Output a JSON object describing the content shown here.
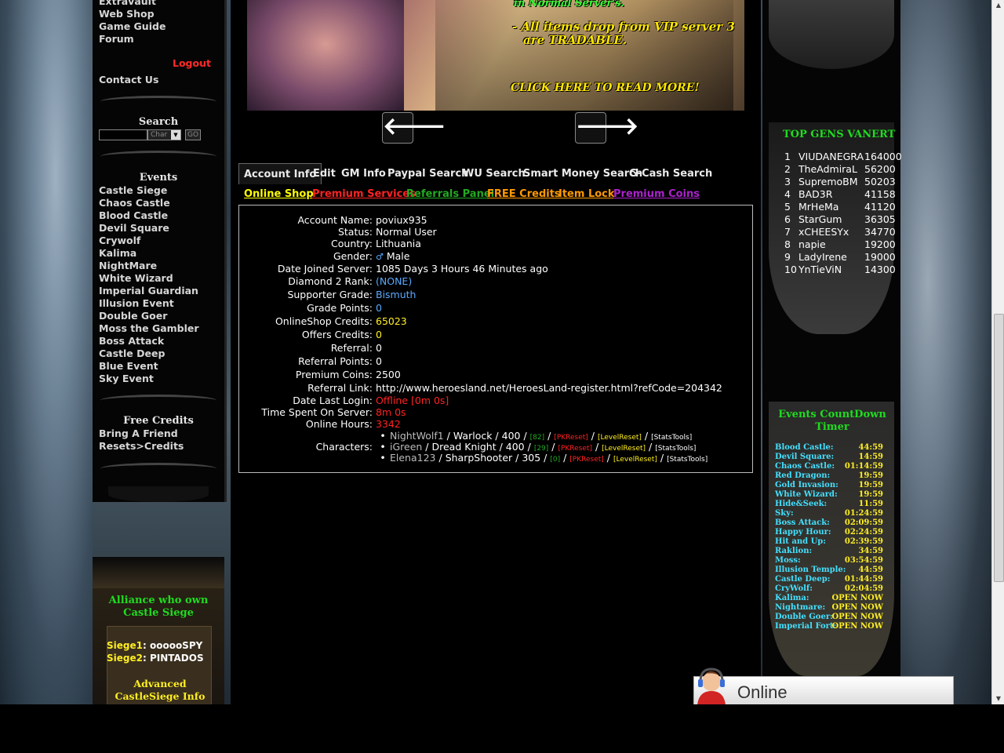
{
  "left_menu": {
    "top_links": [
      "Extravault",
      "Web Shop",
      "Game Guide",
      "Forum"
    ],
    "logout": "Logout",
    "contact": "Contact Us",
    "search": {
      "heading": "Search",
      "select_value": "Char",
      "go_label": "GO"
    },
    "events_heading": "Events",
    "events": [
      "Castle Siege",
      "Chaos Castle",
      "Blood Castle",
      "Devil Square",
      "Crywolf",
      "Kalima",
      "NightMare",
      "White Wizard",
      "Imperial Guardian",
      "Illusion Event",
      "Double Goer",
      "Moss the Gambler",
      "Boss Attack",
      "Castle Deep",
      "Blue Event",
      "Sky Event"
    ],
    "free_credits_heading": "Free Credits",
    "free_credits": [
      "Bring A Friend",
      "Resets>Credits"
    ]
  },
  "castle": {
    "title": "Alliance who own Castle Siege",
    "siege1_label": "Siege1",
    "siege1_value": ": oooooSPY",
    "siege2_label": "Siege2",
    "siege2_value": ": PINTADOS",
    "advanced": "Advanced CastleSiege Info"
  },
  "banner": {
    "line1": "in Normal Server's.",
    "line2": "- All items drop from VIP server 3",
    "line3": "are TRADABLE.",
    "cta": "CLICK HERE TO READ MORE!"
  },
  "nav_arrows": {
    "prev": "🡐",
    "next": "🡒"
  },
  "tabs": [
    "Account Info",
    "Edit",
    "GM Info",
    "Paypal Search",
    "WU Search",
    "Smart Money Search",
    "G-Cash Search"
  ],
  "sub_links": [
    {
      "label": "Online Shop",
      "color": "#ffff00"
    },
    {
      "label": "Premium Services",
      "color": "#ff2222"
    },
    {
      "label": "Referrals Panel",
      "color": "#22aa22"
    },
    {
      "label": "FREE Credits",
      "color": "#ff9900"
    },
    {
      "label": "Item Lock",
      "color": "#ff9900"
    },
    {
      "label": "Premium Coins",
      "color": "#aa22cc"
    }
  ],
  "account": {
    "rows": [
      {
        "label": "Account Name:",
        "value": " poviux935",
        "color": "#ffffff"
      },
      {
        "label": "Status:",
        "value": "Normal User",
        "color": "#ffffff"
      },
      {
        "label": "Country:",
        "value": "Lithuania",
        "color": "#ffffff"
      },
      {
        "label": "Gender:",
        "value": "Male",
        "color": "#ffffff"
      },
      {
        "label": "Date Joined Server:",
        "value": "1085 Days 3 Hours 46 Minutes ago",
        "color": "#ffffff"
      },
      {
        "label": "Diamond 2 Rank:",
        "value": "(NONE)",
        "color": "#5aa9ff"
      },
      {
        "label": "Supporter Grade:",
        "value": "Bismuth",
        "color": "#5aa9ff"
      },
      {
        "label": "Grade Points:",
        "value": "0",
        "color": "#5aa9ff"
      },
      {
        "label": "OnlineShop Credits:",
        "value": "65023",
        "color": "#ffee22"
      },
      {
        "label": "Offers Credits:",
        "value": "0",
        "color": "#ffee22"
      },
      {
        "label": "Referral:",
        "value": "0",
        "color": "#ffffff"
      },
      {
        "label": "Referral Points:",
        "value": "0",
        "color": "#ffffff"
      },
      {
        "label": "Premium Coins:",
        "value": "2500",
        "color": "#ffffff"
      },
      {
        "label": "Referral Link:",
        "value": "http://www.heroesland.net/HeroesLand-register.html?refCode=204342",
        "color": "#ffffff"
      },
      {
        "label": "Date Last Login:",
        "value": "Offline [0m 0s]",
        "color": "#ff2222"
      },
      {
        "label": "Time Spent On Server:",
        "value": "8m 0s",
        "color": "#ff2222"
      },
      {
        "label": "Online Hours:",
        "value": "3342",
        "color": "#ff2222"
      }
    ],
    "characters_label": "Characters:",
    "characters": [
      {
        "name": "NightWolf1",
        "class": "Warlock",
        "level": "400",
        "resets": "[82]",
        "pk": "[PKReset]",
        "lvl": "[LevelReset]",
        "stats": "[StatsTools]"
      },
      {
        "name": "iGreen",
        "class": "Dread Knight",
        "level": "400",
        "resets": "[29]",
        "pk": "[PKReset]",
        "lvl": "[LevelReset]",
        "stats": "[StatsTools]"
      },
      {
        "name": "Elena123",
        "class": "SharpShooter",
        "level": "305",
        "resets": "[0]",
        "pk": "[PKReset]",
        "lvl": "[LevelReset]",
        "stats": "[StatsTools]"
      }
    ]
  },
  "gens": {
    "title": "TOP GENS VANERT",
    "rows": [
      {
        "rank": "1",
        "name": "VIUDANEGRA",
        "score": "164000"
      },
      {
        "rank": "2",
        "name": "TheAdmiraL",
        "score": "56200"
      },
      {
        "rank": "3",
        "name": "SupremoBM",
        "score": "50203"
      },
      {
        "rank": "4",
        "name": "BAD3R",
        "score": "41158"
      },
      {
        "rank": "5",
        "name": "MrHeMa",
        "score": "41120"
      },
      {
        "rank": "6",
        "name": "StarGum",
        "score": "36305"
      },
      {
        "rank": "7",
        "name": "xCHEESYx",
        "score": "34770"
      },
      {
        "rank": "8",
        "name": "napie",
        "score": "19200"
      },
      {
        "rank": "9",
        "name": "LadyIrene",
        "score": "19000"
      },
      {
        "rank": "10",
        "name": "YnTieViN",
        "score": "14300"
      }
    ]
  },
  "events_timer": {
    "title": "Events CountDown Timer",
    "rows": [
      {
        "name": "Blood Castle:",
        "time": "44:59"
      },
      {
        "name": "Devil Square:",
        "time": "14:59"
      },
      {
        "name": "Chaos Castle:",
        "time": "01:14:59"
      },
      {
        "name": "Red Dragon:",
        "time": "19:59"
      },
      {
        "name": "Gold Invasion:",
        "time": "19:59"
      },
      {
        "name": "White Wizard:",
        "time": "19:59"
      },
      {
        "name": "Hide&Seek:",
        "time": "11:59"
      },
      {
        "name": "Sky:",
        "time": "01:24:59"
      },
      {
        "name": "Boss Attack:",
        "time": "02:09:59"
      },
      {
        "name": "Happy Hour:",
        "time": "02:24:59"
      },
      {
        "name": "Hit and Up:",
        "time": "02:39:59"
      },
      {
        "name": "Raklion:",
        "time": "34:59"
      },
      {
        "name": "Moss:",
        "time": "03:54:59"
      },
      {
        "name": "Illusion Temple:",
        "time": "44:59"
      },
      {
        "name": "Castle Deep:",
        "time": "01:44:59"
      },
      {
        "name": "CryWolf:",
        "time": "02:04:59"
      },
      {
        "name": "Kalima:",
        "time": "OPEN NOW"
      },
      {
        "name": "Nightmare:",
        "time": "OPEN NOW"
      },
      {
        "name": "Double Goer:",
        "time": "OPEN NOW"
      },
      {
        "name": "Imperial Fort:",
        "time": "OPEN NOW"
      }
    ]
  },
  "online_widget": {
    "label": "Online"
  }
}
